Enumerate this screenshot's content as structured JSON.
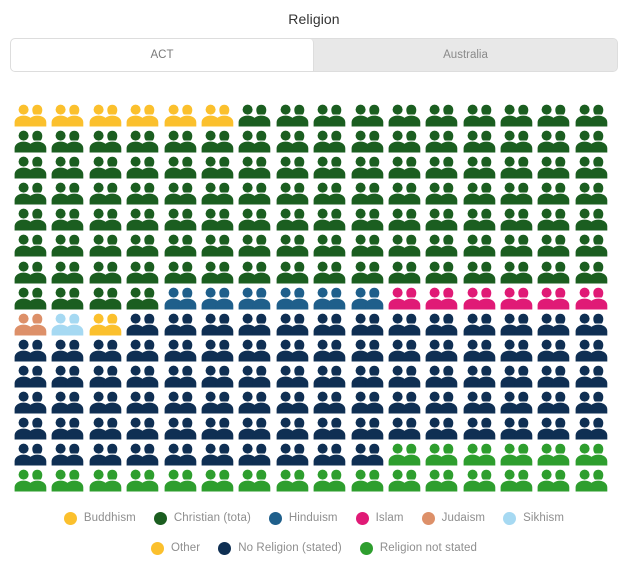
{
  "title": "Religion",
  "tabs": [
    {
      "label": "ACT",
      "active": true
    },
    {
      "label": "Australia",
      "active": false
    }
  ],
  "legend": [
    {
      "label": "Buddhism",
      "color": "#fbc02d"
    },
    {
      "label": "Christian (tota)",
      "color": "#1b5e20"
    },
    {
      "label": "Hinduism",
      "color": "#1f5f8b"
    },
    {
      "label": "Islam",
      "color": "#e01a76"
    },
    {
      "label": "Judaism",
      "color": "#dd9069"
    },
    {
      "label": "Sikhism",
      "color": "#a6d9f2"
    },
    {
      "label": "Other",
      "color": "#fbc02d"
    },
    {
      "label": "No Religion (stated)",
      "color": "#0f2f53"
    },
    {
      "label": "Religion not stated",
      "color": "#2e9e2e"
    }
  ],
  "legend_rows": [
    [
      "Buddhism",
      "Christian (tota)",
      "Hinduism",
      "Islam",
      "Judaism",
      "Sikhism"
    ],
    [
      "Other",
      "No Religion (stated)",
      "Religion not stated"
    ]
  ],
  "chart_data": {
    "type": "pictogram",
    "title": "Religion",
    "region": "ACT",
    "icon": "two-people-icon",
    "columns": 16,
    "rows": 15,
    "total_icons": 240,
    "unit_note": "each icon represents an equal share of the population",
    "categories": [
      "Buddhism",
      "Christian (tota)",
      "Hinduism",
      "Islam",
      "Judaism",
      "Sikhism",
      "Other",
      "No Religion (stated)",
      "Religion not stated"
    ],
    "values": [
      6,
      110,
      6,
      6,
      1,
      1,
      1,
      87,
      22
    ],
    "colors": [
      "#fbc02d",
      "#1b5e20",
      "#1f5f8b",
      "#e01a76",
      "#dd9069",
      "#a6d9f2",
      "#fbc02d",
      "#0f2f53",
      "#2e9e2e"
    ],
    "grid_sequence": [
      {
        "category": "Buddhism",
        "color": "#fbc02d",
        "count": 6
      },
      {
        "category": "Christian (tota)",
        "color": "#1b5e20",
        "count": 110
      },
      {
        "category": "Hinduism",
        "color": "#1f5f8b",
        "count": 6
      },
      {
        "category": "Islam",
        "color": "#e01a76",
        "count": 6
      },
      {
        "category": "Judaism",
        "color": "#dd9069",
        "count": 1
      },
      {
        "category": "Sikhism",
        "color": "#a6d9f2",
        "count": 1
      },
      {
        "category": "Other",
        "color": "#fbc02d",
        "count": 1
      },
      {
        "category": "No Religion (stated)",
        "color": "#0f2f53",
        "count": 87
      },
      {
        "category": "Religion not stated",
        "color": "#2e9e2e",
        "count": 22
      }
    ],
    "xlabel": "",
    "ylabel": "",
    "legend_position": "bottom"
  }
}
